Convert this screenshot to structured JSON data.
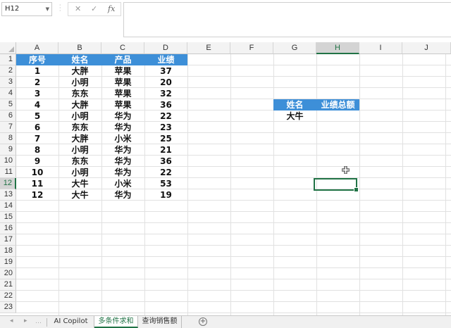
{
  "formula_bar": {
    "name_box": "H12",
    "cancel_glyph": "✕",
    "enter_glyph": "✓",
    "fx_glyph": "fx",
    "formula": ""
  },
  "columns": [
    "A",
    "B",
    "C",
    "D",
    "E",
    "F",
    "G",
    "H",
    "I",
    "J"
  ],
  "rows": [
    "1",
    "2",
    "3",
    "4",
    "5",
    "6",
    "7",
    "8",
    "9",
    "10",
    "11",
    "12",
    "13",
    "14",
    "15",
    "16",
    "17",
    "18",
    "19",
    "20",
    "21",
    "22",
    "23"
  ],
  "selected_cell": "H12",
  "table": {
    "headers": [
      "序号",
      "姓名",
      "产品",
      "业绩"
    ],
    "rows": [
      [
        "1",
        "大胖",
        "苹果",
        "37"
      ],
      [
        "2",
        "小明",
        "苹果",
        "20"
      ],
      [
        "3",
        "东东",
        "苹果",
        "32"
      ],
      [
        "4",
        "大胖",
        "苹果",
        "36"
      ],
      [
        "5",
        "小明",
        "华为",
        "22"
      ],
      [
        "6",
        "东东",
        "华为",
        "23"
      ],
      [
        "7",
        "大胖",
        "小米",
        "25"
      ],
      [
        "8",
        "小明",
        "华为",
        "21"
      ],
      [
        "9",
        "东东",
        "华为",
        "36"
      ],
      [
        "10",
        "小明",
        "华为",
        "22"
      ],
      [
        "11",
        "大牛",
        "小米",
        "53"
      ],
      [
        "12",
        "大牛",
        "华为",
        "19"
      ]
    ]
  },
  "lookup": {
    "headers": [
      "姓名",
      "业绩总额"
    ],
    "name_value": "大牛",
    "total_value": ""
  },
  "sheet_tabs": [
    "AI Copilot",
    "多条件求和",
    "查询销售额"
  ],
  "active_tab": "多条件求和",
  "colors": {
    "table_header": "#3d8fd8",
    "accent": "#217346"
  }
}
